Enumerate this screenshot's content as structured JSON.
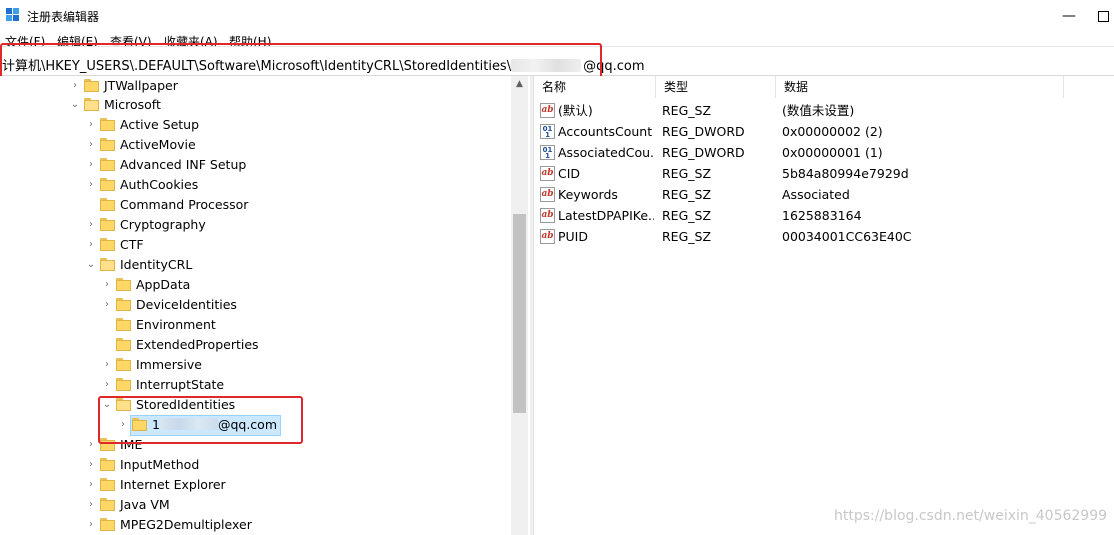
{
  "window": {
    "title": "注册表编辑器",
    "minimize_glyph": "—"
  },
  "menu": {
    "items": [
      "文件(F)",
      "编辑(E)",
      "查看(V)",
      "收藏夹(A)",
      "帮助(H)"
    ]
  },
  "address": {
    "path_prefix": "计算机\\HKEY_USERS\\.DEFAULT\\Software\\Microsoft\\IdentityCRL\\StoredIdentities\\",
    "path_suffix": "@qq.com"
  },
  "tree": {
    "items": [
      {
        "label": "JTWallpaper"
      },
      {
        "label": "Microsoft"
      },
      {
        "label": "Active Setup"
      },
      {
        "label": "ActiveMovie"
      },
      {
        "label": "Advanced INF Setup"
      },
      {
        "label": "AuthCookies"
      },
      {
        "label": "Command Processor"
      },
      {
        "label": "Cryptography"
      },
      {
        "label": "CTF"
      },
      {
        "label": "IdentityCRL"
      },
      {
        "label": "AppData"
      },
      {
        "label": "DeviceIdentities"
      },
      {
        "label": "Environment"
      },
      {
        "label": "ExtendedProperties"
      },
      {
        "label": "Immersive"
      },
      {
        "label": "InterruptState"
      },
      {
        "label": "StoredIdentities"
      },
      {
        "label_prefix": "1",
        "label_suffix": "@qq.com"
      },
      {
        "label": "IME"
      },
      {
        "label": "InputMethod"
      },
      {
        "label": "Internet Explorer"
      },
      {
        "label": "Java VM"
      },
      {
        "label": "MPEG2Demultiplexer"
      }
    ]
  },
  "list": {
    "columns": [
      "名称",
      "类型",
      "数据"
    ],
    "rows": [
      {
        "name": "(默认)",
        "type": "REG_SZ",
        "data": "(数值未设置)",
        "icon": "ab"
      },
      {
        "name": "AccountsCount",
        "type": "REG_DWORD",
        "data": "0x00000002 (2)",
        "icon": "011"
      },
      {
        "name": "AssociatedCou...",
        "type": "REG_DWORD",
        "data": "0x00000001 (1)",
        "icon": "011"
      },
      {
        "name": "CID",
        "type": "REG_SZ",
        "data": "5b84a80994e7929d",
        "icon": "ab"
      },
      {
        "name": "Keywords",
        "type": "REG_SZ",
        "data": "Associated",
        "icon": "ab"
      },
      {
        "name": "LatestDPAPIKe...",
        "type": "REG_SZ",
        "data": "1625883164",
        "icon": "ab"
      },
      {
        "name": "PUID",
        "type": "REG_SZ",
        "data": "00034001CC63E40C",
        "icon": "ab"
      }
    ]
  },
  "watermark": "https://blog.csdn.net/weixin_40562999",
  "colors": {
    "highlight_border": "#e0282a",
    "selection_bg": "#cce8ff",
    "folder": "#ffd766"
  }
}
